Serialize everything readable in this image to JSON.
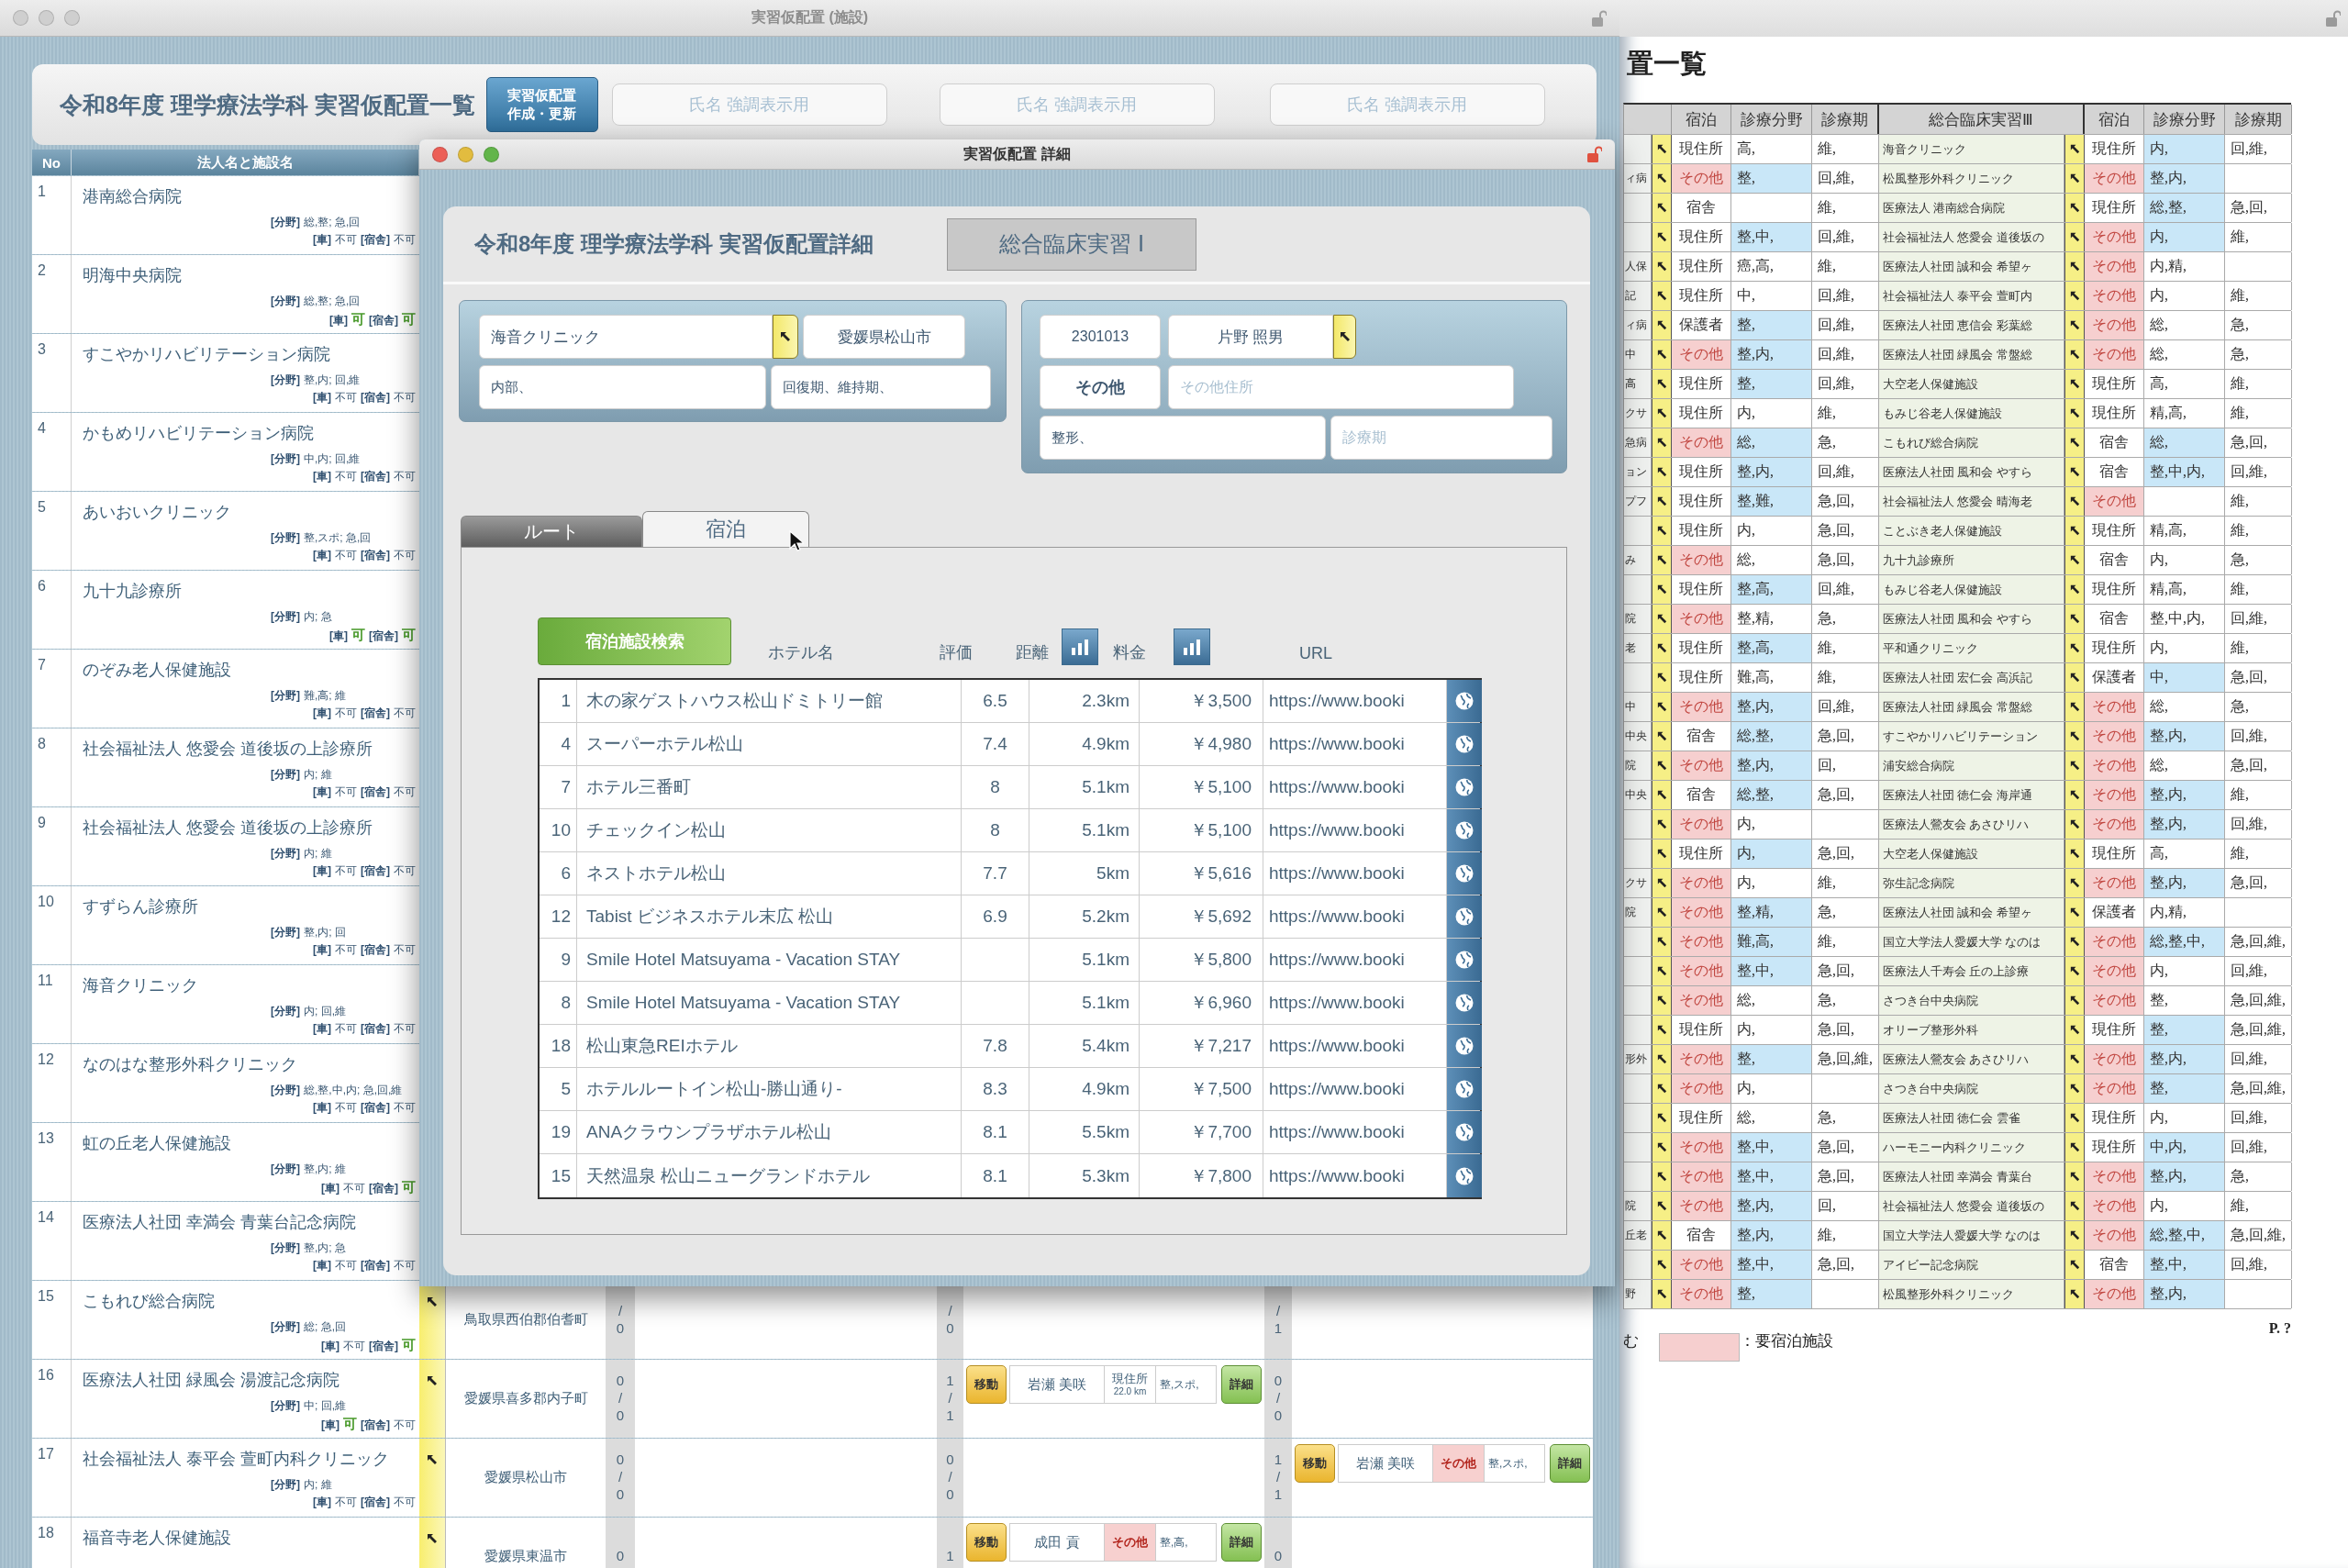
{
  "main_window": {
    "title": "実習仮配置 (施設)",
    "heading": "令和8年度 理学療法学科 実習仮配置一覧",
    "update_button": [
      "実習仮配置",
      "作成・更新"
    ],
    "highlight_fields": [
      {
        "placeholder": "氏名 強調表示用"
      },
      {
        "placeholder": "氏名 強調表示用"
      },
      {
        "placeholder": "氏名 強調表示用"
      }
    ],
    "columns": [
      "No",
      "法人名と施設名"
    ],
    "rows": [
      {
        "no": "1",
        "name": "港南総合病院",
        "field_label": "[分野]",
        "field": "総,整; 急,回",
        "car_label": "[車]",
        "car": "不可",
        "car_ok": false,
        "dorm_label": "[宿舎]",
        "dorm": "不可",
        "dorm_ok": false
      },
      {
        "no": "2",
        "name": "明海中央病院",
        "field_label": "[分野]",
        "field": "総,整; 急,回",
        "car_label": "[車]",
        "car": "可",
        "car_ok": true,
        "dorm_label": "[宿舎]",
        "dorm": "可",
        "dorm_ok": true
      },
      {
        "no": "3",
        "name": "すこやかリハビリテーション病院",
        "field_label": "[分野]",
        "field": "整,内; 回,維",
        "car_label": "[車]",
        "car": "不可",
        "car_ok": false,
        "dorm_label": "[宿舎]",
        "dorm": "不可",
        "dorm_ok": false
      },
      {
        "no": "4",
        "name": "かもめリハビリテーション病院",
        "field_label": "[分野]",
        "field": "中,内; 回,維",
        "car_label": "[車]",
        "car": "不可",
        "car_ok": false,
        "dorm_label": "[宿舎]",
        "dorm": "不可",
        "dorm_ok": false
      },
      {
        "no": "5",
        "name": "あいおいクリニック",
        "field_label": "[分野]",
        "field": "整,スポ; 急,回",
        "car_label": "[車]",
        "car": "不可",
        "car_ok": false,
        "dorm_label": "[宿舎]",
        "dorm": "不可",
        "dorm_ok": false
      },
      {
        "no": "6",
        "name": "九十九診療所",
        "field_label": "[分野]",
        "field": "内; 急",
        "car_label": "[車]",
        "car": "可",
        "car_ok": true,
        "dorm_label": "[宿舎]",
        "dorm": "可",
        "dorm_ok": true
      },
      {
        "no": "7",
        "name": "のぞみ老人保健施設",
        "field_label": "[分野]",
        "field": "難,高; 維",
        "car_label": "[車]",
        "car": "不可",
        "car_ok": false,
        "dorm_label": "[宿舎]",
        "dorm": "不可",
        "dorm_ok": false
      },
      {
        "no": "8",
        "name": "社会福祉法人 悠愛会 道後坂の上診療所",
        "field_label": "[分野]",
        "field": "内; 維",
        "car_label": "[車]",
        "car": "不可",
        "car_ok": false,
        "dorm_label": "[宿舎]",
        "dorm": "不可",
        "dorm_ok": false
      },
      {
        "no": "9",
        "name": "社会福祉法人 悠愛会 道後坂の上診療所",
        "field_label": "[分野]",
        "field": "内; 維",
        "car_label": "[車]",
        "car": "不可",
        "car_ok": false,
        "dorm_label": "[宿舎]",
        "dorm": "不可",
        "dorm_ok": false
      },
      {
        "no": "10",
        "name": "すずらん診療所",
        "field_label": "[分野]",
        "field": "整,内; 回",
        "car_label": "[車]",
        "car": "不可",
        "car_ok": false,
        "dorm_label": "[宿舎]",
        "dorm": "不可",
        "dorm_ok": false
      },
      {
        "no": "11",
        "name": "海音クリニック",
        "field_label": "[分野]",
        "field": "内; 回,維",
        "car_label": "[車]",
        "car": "不可",
        "car_ok": false,
        "dorm_label": "[宿舎]",
        "dorm": "不可",
        "dorm_ok": false
      },
      {
        "no": "12",
        "name": "なのはな整形外科クリニック",
        "field_label": "[分野]",
        "field": "総,整,中,内; 急,回,維",
        "car_label": "[車]",
        "car": "不可",
        "car_ok": false,
        "dorm_label": "[宿舎]",
        "dorm": "不可",
        "dorm_ok": false
      },
      {
        "no": "13",
        "name": "虹の丘老人保健施設",
        "field_label": "[分野]",
        "field": "整,内; 維",
        "car_label": "[車]",
        "car": "不可",
        "car_ok": false,
        "dorm_label": "[宿舎]",
        "dorm": "可",
        "dorm_ok": true
      },
      {
        "no": "14",
        "name": "医療法人社団 幸満会 青葉台記念病院",
        "field_label": "[分野]",
        "field": "整,内; 急",
        "car_label": "[車]",
        "car": "不可",
        "car_ok": false,
        "dorm_label": "[宿舎]",
        "dorm": "不可",
        "dorm_ok": false
      },
      {
        "no": "15",
        "name": "こもれび総合病院",
        "field_label": "[分野]",
        "field": "総; 急,回",
        "car_label": "[車]",
        "car": "不可",
        "car_ok": false,
        "dorm_label": "[宿舎]",
        "dorm": "可",
        "dorm_ok": true,
        "address": "鳥取県西伯郡伯耆町",
        "slots": [
          {
            "count": [
              "/",
              "0"
            ]
          },
          {
            "count": [
              "/",
              "0"
            ]
          },
          {
            "count": [
              "/",
              "1"
            ]
          }
        ]
      },
      {
        "no": "16",
        "name": "医療法人社団 緑風会 湯渡記念病院",
        "field_label": "[分野]",
        "field": "中; 回,維",
        "car_label": "[車]",
        "car": "可",
        "car_ok": true,
        "dorm_label": "[宿舎]",
        "dorm": "不可",
        "dorm_ok": false,
        "address": "愛媛県喜多郡内子町",
        "slots": [
          {
            "count": [
              "0",
              "/",
              "0"
            ]
          },
          {
            "count": [
              "1",
              "/",
              "1"
            ],
            "entry": {
              "move": "移動",
              "name": "岩瀬 美咲",
              "residence": "現住所",
              "distance": "22.0 km",
              "lodging": false,
              "field": "整,スポ,",
              "detail": "詳細"
            }
          },
          {
            "count": [
              "0",
              "/",
              "0"
            ]
          }
        ]
      },
      {
        "no": "17",
        "name": "社会福祉法人 泰平会 萱町内科クリニック",
        "field_label": "[分野]",
        "field": "内; 維",
        "car_label": "[車]",
        "car": "不可",
        "car_ok": false,
        "dorm_label": "[宿舎]",
        "dorm": "不可",
        "dorm_ok": false,
        "address": "愛媛県松山市",
        "slots": [
          {
            "count": [
              "0",
              "/",
              "0"
            ]
          },
          {
            "count": [
              "0",
              "/",
              "0"
            ]
          },
          {
            "count": [
              "1",
              "/",
              "1"
            ],
            "entry": {
              "move": "移動",
              "name": "岩瀬 美咲",
              "residence": "その他",
              "lodging": true,
              "field": "整,スポ,",
              "detail": "詳細"
            }
          }
        ]
      },
      {
        "no": "18",
        "name": "福音寺老人保健施設",
        "address": "愛媛県東温市",
        "slots": [
          {
            "count": [
              "0"
            ]
          },
          {
            "count": [
              "1"
            ],
            "entry": {
              "move": "移動",
              "name": "成田 貢",
              "residence": "その他",
              "lodging": true,
              "field": "整,高,",
              "detail": "詳細"
            }
          },
          {
            "count": [
              "0"
            ]
          }
        ]
      }
    ]
  },
  "detail_window": {
    "title": "実習仮配置 詳細",
    "heading": "令和8年度 理学療法学科 実習仮配置詳細",
    "course": "総合臨床実習 Ⅰ",
    "facility": {
      "name": "海音クリニック",
      "city": "愛媛県松山市",
      "departments": "内部、",
      "phases": "回復期、維持期、"
    },
    "student": {
      "id": "2301013",
      "name": "片野 照男",
      "residence": "その他",
      "address_placeholder": "その他住所",
      "field": "整形、",
      "period_placeholder": "診療期"
    },
    "tabs": [
      {
        "label": "ルート",
        "selected": false
      },
      {
        "label": "宿泊",
        "selected": true
      }
    ],
    "search_button": "宿泊施設検索",
    "columns": [
      "ホテル名",
      "評価",
      "距離",
      "料金",
      "URL"
    ],
    "hotels": [
      {
        "no": "1",
        "name": "木の家ゲストハウス松山ドミトリー館",
        "rating": "6.5",
        "distance": "2.3km",
        "price": "￥3,500",
        "url": "https://www.booki"
      },
      {
        "no": "4",
        "name": "スーパーホテル松山",
        "rating": "7.4",
        "distance": "4.9km",
        "price": "￥4,980",
        "url": "https://www.booki"
      },
      {
        "no": "7",
        "name": "ホテル三番町",
        "rating": "8",
        "distance": "5.1km",
        "price": "￥5,100",
        "url": "https://www.booki"
      },
      {
        "no": "10",
        "name": "チェックイン松山",
        "rating": "8",
        "distance": "5.1km",
        "price": "￥5,100",
        "url": "https://www.booki"
      },
      {
        "no": "6",
        "name": "ネストホテル松山",
        "rating": "7.7",
        "distance": "5km",
        "price": "￥5,616",
        "url": "https://www.booki"
      },
      {
        "no": "12",
        "name": "Tabist ビジネスホテル末広 松山",
        "rating": "6.9",
        "distance": "5.2km",
        "price": "￥5,692",
        "url": "https://www.booki"
      },
      {
        "no": "9",
        "name": "Smile Hotel Matsuyama - Vacation STAY",
        "distance": "5.1km",
        "price": "￥5,800",
        "url": "https://www.booki"
      },
      {
        "no": "8",
        "name": "Smile Hotel Matsuyama - Vacation STAY",
        "distance": "5.1km",
        "price": "￥6,960",
        "url": "https://www.booki"
      },
      {
        "no": "18",
        "name": "松山東急REIホテル",
        "rating": "7.8",
        "distance": "5.4km",
        "price": "￥7,217",
        "url": "https://www.booki"
      },
      {
        "no": "5",
        "name": "ホテルルートイン松山-勝山通り-",
        "rating": "8.3",
        "distance": "4.9km",
        "price": "￥7,500",
        "url": "https://www.booki"
      },
      {
        "no": "19",
        "name": "ANAクラウンプラザホテル松山",
        "rating": "8.1",
        "distance": "5.5km",
        "price": "￥7,700",
        "url": "https://www.booki"
      },
      {
        "no": "15",
        "name": "天然温泉 松山ニューグランドホテル",
        "rating": "8.1",
        "distance": "5.3km",
        "price": "￥7,800",
        "url": "https://www.booki"
      }
    ]
  },
  "roster_window": {
    "title": "置一覧",
    "columns": [
      "宿泊",
      "診療分野",
      "診療期",
      "総合臨床実習Ⅲ",
      "宿泊",
      "診療分野",
      "診療期"
    ],
    "rows": [
      {
        "stay1": "現住所",
        "lodging1": false,
        "field1": "高,",
        "mark1": false,
        "period1": "維,",
        "facility": "海音クリニック",
        "stay2": "現住所",
        "lodging2": false,
        "field2": "内,",
        "mark2": true,
        "period2": "回,維,"
      },
      {
        "cut": "ィ病",
        "stay1": "その他",
        "lodging1": true,
        "field1": "整,",
        "mark1": true,
        "period1": "回,維,",
        "facility": "松風整形外科クリニック",
        "stay2": "その他",
        "lodging2": true,
        "field2": "整,内,",
        "mark2": true
      },
      {
        "stay1": "宿舎",
        "lodging1": false,
        "mark1": false,
        "period1": "維,",
        "facility": "医療法人 港南総合病院",
        "stay2": "現住所",
        "lodging2": false,
        "field2": "総,整,",
        "mark2": true,
        "period2": "急,回,"
      },
      {
        "stay1": "現住所",
        "lodging1": false,
        "field1": "整,中,",
        "mark1": true,
        "period1": "回,維,",
        "facility": "社会福祉法人 悠愛会 道後坂の",
        "stay2": "その他",
        "lodging2": true,
        "field2": "内,",
        "mark2": true,
        "period2": "維,"
      },
      {
        "cut": "人保",
        "stay1": "現住所",
        "lodging1": false,
        "field1": "癌,高,",
        "mark1": false,
        "period1": "維,",
        "facility": "医療法人社団 誠和会 希望ヶ",
        "stay2": "その他",
        "lodging2": true,
        "field2": "内,精,",
        "mark2": false
      },
      {
        "cut": "記",
        "stay1": "現住所",
        "lodging1": false,
        "field1": "中,",
        "mark1": false,
        "period1": "回,維,",
        "facility": "社会福祉法人 泰平会 萱町内",
        "stay2": "その他",
        "lodging2": true,
        "field2": "内,",
        "mark2": false,
        "period2": "維,"
      },
      {
        "cut": "ィ病",
        "stay1": "保護者",
        "lodging1": false,
        "field1": "整,",
        "mark1": true,
        "period1": "回,維,",
        "facility": "医療法人社団 恵信会 彩葉総",
        "stay2": "その他",
        "lodging2": true,
        "field2": "総,",
        "mark2": false,
        "period2": "急,"
      },
      {
        "cut": "中",
        "stay1": "その他",
        "lodging1": true,
        "field1": "整,内,",
        "mark1": true,
        "period1": "回,維,",
        "facility": "医療法人社団 緑風会 常盤総",
        "stay2": "その他",
        "lodging2": true,
        "field2": "総,",
        "mark2": false,
        "period2": "急,"
      },
      {
        "cut": "高",
        "stay1": "現住所",
        "lodging1": false,
        "field1": "整,",
        "mark1": true,
        "period1": "回,維,",
        "facility": "大空老人保健施設",
        "stay2": "現住所",
        "lodging2": false,
        "field2": "高,",
        "mark2": false,
        "period2": "維,"
      },
      {
        "cut": "クサ",
        "stay1": "現住所",
        "lodging1": false,
        "field1": "内,",
        "mark1": false,
        "period1": "維,",
        "facility": "もみじ谷老人保健施設",
        "stay2": "現住所",
        "lodging2": false,
        "field2": "精,高,",
        "mark2": false,
        "period2": "維,"
      },
      {
        "cut": "急病",
        "stay1": "その他",
        "lodging1": true,
        "field1": "総,",
        "mark1": true,
        "period1": "急,",
        "facility": "こもれび総合病院",
        "stay2": "宿舎",
        "lodging2": false,
        "field2": "総,",
        "mark2": true,
        "period2": "急,回,"
      },
      {
        "cut": "ョン",
        "stay1": "現住所",
        "lodging1": false,
        "field1": "整,内,",
        "mark1": true,
        "period1": "回,維,",
        "facility": "医療法人社団 風和会 やすら",
        "stay2": "宿舎",
        "lodging2": false,
        "field2": "整,中,内,",
        "mark2": true,
        "period2": "回,維,"
      },
      {
        "cut": "プフ",
        "stay1": "現住所",
        "lodging1": false,
        "field1": "整,難,",
        "mark1": true,
        "period1": "急,回,",
        "facility": "社会福祉法人 悠愛会 晴海老",
        "stay2": "その他",
        "lodging2": true,
        "mark2": false,
        "period2": "維,"
      },
      {
        "stay1": "現住所",
        "lodging1": false,
        "field1": "内,",
        "mark1": false,
        "period1": "急,回,",
        "facility": "ことぶき老人保健施設",
        "stay2": "現住所",
        "lodging2": false,
        "field2": "精,高,",
        "mark2": false,
        "period2": "維,"
      },
      {
        "cut": "み",
        "stay1": "その他",
        "lodging1": true,
        "field1": "総,",
        "mark1": false,
        "period1": "急,回,",
        "facility": "九十九診療所",
        "stay2": "宿舎",
        "lodging2": false,
        "field2": "内,",
        "mark2": false,
        "period2": "急,"
      },
      {
        "stay1": "現住所",
        "lodging1": false,
        "field1": "整,高,",
        "mark1": true,
        "period1": "回,維,",
        "facility": "もみじ谷老人保健施設",
        "stay2": "現住所",
        "lodging2": false,
        "field2": "精,高,",
        "mark2": false,
        "period2": "維,"
      },
      {
        "cut": "院",
        "stay1": "その他",
        "lodging1": true,
        "field1": "整,精,",
        "mark1": false,
        "period1": "急,",
        "facility": "医療法人社団 風和会 やすら",
        "stay2": "宿舎",
        "lodging2": false,
        "field2": "整,中,内,",
        "mark2": false,
        "period2": "回,維,"
      },
      {
        "cut": "老",
        "stay1": "現住所",
        "lodging1": false,
        "field1": "整,高,",
        "mark1": true,
        "period1": "維,",
        "facility": "平和通クリニック",
        "stay2": "現住所",
        "lodging2": false,
        "field2": "内,",
        "mark2": false,
        "period2": "維,"
      },
      {
        "stay1": "現住所",
        "lodging1": false,
        "field1": "難,高,",
        "mark1": false,
        "period1": "維,",
        "facility": "医療法人社団 宏仁会 高浜記",
        "stay2": "保護者",
        "lodging2": false,
        "field2": "中,",
        "mark2": true,
        "period2": "急,回,"
      },
      {
        "cut": "中",
        "stay1": "その他",
        "lodging1": true,
        "field1": "整,内,",
        "mark1": true,
        "period1": "回,維,",
        "facility": "医療法人社団 緑風会 常盤総",
        "stay2": "その他",
        "lodging2": true,
        "field2": "総,",
        "mark2": false,
        "period2": "急,"
      },
      {
        "cut": "中央",
        "stay1": "宿舎",
        "lodging1": false,
        "field1": "総,整,",
        "mark1": true,
        "period1": "急,回,",
        "facility": "すこやかリハビリテーション",
        "stay2": "その他",
        "lodging2": true,
        "field2": "整,内,",
        "mark2": true,
        "period2": "回,維,"
      },
      {
        "cut": "院",
        "stay1": "その他",
        "lodging1": true,
        "field1": "整,内,",
        "mark1": true,
        "period1": "回,",
        "facility": "浦安総合病院",
        "stay2": "その他",
        "lodging2": true,
        "field2": "総,",
        "mark2": false,
        "period2": "急,回,"
      },
      {
        "cut": "中央",
        "stay1": "宿舎",
        "lodging1": false,
        "field1": "総,整,",
        "mark1": true,
        "period1": "急,回,",
        "facility": "医療法人社団 徳仁会 海岸通",
        "stay2": "その他",
        "lodging2": true,
        "field2": "整,内,",
        "mark2": true,
        "period2": "維,"
      },
      {
        "stay1": "その他",
        "lodging1": true,
        "field1": "内,",
        "mark1": false,
        "facility": "医療法人鶯友会 あさひリハ",
        "stay2": "その他",
        "lodging2": true,
        "field2": "整,内,",
        "mark2": true,
        "period2": "回,維,"
      },
      {
        "stay1": "現住所",
        "lodging1": false,
        "field1": "内,",
        "mark1": true,
        "period1": "急,回,",
        "facility": "大空老人保健施設",
        "stay2": "現住所",
        "lodging2": false,
        "field2": "高,",
        "mark2": false,
        "period2": "維,"
      },
      {
        "cut": "クサ",
        "stay1": "その他",
        "lodging1": true,
        "field1": "内,",
        "mark1": false,
        "period1": "維,",
        "facility": "弥生記念病院",
        "stay2": "その他",
        "lodging2": true,
        "field2": "整,内,",
        "mark2": true,
        "period2": "急,回,"
      },
      {
        "cut": "院",
        "stay1": "その他",
        "lodging1": true,
        "field1": "整,精,",
        "mark1": true,
        "period1": "急,",
        "facility": "医療法人社団 誠和会 希望ヶ",
        "stay2": "保護者",
        "lodging2": false,
        "field2": "内,精,",
        "mark2": false
      },
      {
        "stay1": "その他",
        "lodging1": true,
        "field1": "難,高,",
        "mark1": true,
        "period1": "維,",
        "facility": "国立大学法人愛媛大学 なのは",
        "stay2": "その他",
        "lodging2": true,
        "field2": "総,整,中,",
        "mark2": true,
        "period2": "急,回,維,"
      },
      {
        "stay1": "その他",
        "lodging1": true,
        "field1": "整,中,",
        "mark1": true,
        "period1": "急,回,",
        "facility": "医療法人千寿会 丘の上診療",
        "stay2": "その他",
        "lodging2": true,
        "field2": "内,",
        "mark2": false,
        "period2": "回,維,"
      },
      {
        "stay1": "その他",
        "lodging1": true,
        "field1": "総,",
        "mark1": false,
        "period1": "急,",
        "facility": "さつき台中央病院",
        "stay2": "その他",
        "lodging2": true,
        "field2": "整,",
        "mark2": false,
        "period2": "急,回,維,"
      },
      {
        "stay1": "現住所",
        "lodging1": false,
        "field1": "内,",
        "mark1": false,
        "period1": "急,回,",
        "facility": "オリーブ整形外科",
        "stay2": "現住所",
        "lodging2": false,
        "field2": "整,",
        "mark2": true,
        "period2": "急,回,維,"
      },
      {
        "cut": "形外",
        "stay1": "その他",
        "lodging1": true,
        "field1": "整,",
        "mark1": true,
        "period1": "急,回,維,",
        "facility": "医療法人鶯友会 あさひリハ",
        "stay2": "その他",
        "lodging2": true,
        "field2": "整,内,",
        "mark2": true,
        "period2": "回,維,"
      },
      {
        "stay1": "その他",
        "lodging1": true,
        "field1": "内,",
        "mark1": false,
        "facility": "さつき台中央病院",
        "stay2": "その他",
        "lodging2": true,
        "field2": "整,",
        "mark2": true,
        "period2": "急,回,維,"
      },
      {
        "stay1": "現住所",
        "lodging1": false,
        "field1": "総,",
        "mark1": false,
        "period1": "急,",
        "facility": "医療法人社団 徳仁会 雲雀",
        "stay2": "現住所",
        "lodging2": false,
        "field2": "内,",
        "mark2": false,
        "period2": "回,維,"
      },
      {
        "stay1": "その他",
        "lodging1": true,
        "field1": "整,中,",
        "mark1": true,
        "period1": "急,回,",
        "facility": "ハーモニー内科クリニック",
        "stay2": "現住所",
        "lodging2": false,
        "field2": "中,内,",
        "mark2": true,
        "period2": "回,維,"
      },
      {
        "stay1": "その他",
        "lodging1": true,
        "field1": "整,中,",
        "mark1": true,
        "period1": "急,回,",
        "facility": "医療法人社団 幸満会 青葉台",
        "stay2": "その他",
        "lodging2": true,
        "field2": "整,内,",
        "mark2": true,
        "period2": "急,"
      },
      {
        "cut": "院",
        "stay1": "その他",
        "lodging1": true,
        "field1": "整,内,",
        "mark1": true,
        "period1": "回,",
        "facility": "社会福祉法人 悠愛会 道後坂の",
        "stay2": "その他",
        "lodging2": true,
        "field2": "内,",
        "mark2": false,
        "period2": "維,"
      },
      {
        "cut": "丘老",
        "stay1": "宿舎",
        "lodging1": false,
        "field1": "整,内,",
        "mark1": true,
        "period1": "維,",
        "facility": "国立大学法人愛媛大学 なのは",
        "stay2": "その他",
        "lodging2": true,
        "field2": "総,整,中,",
        "mark2": true,
        "period2": "急,回,維,"
      },
      {
        "stay1": "その他",
        "lodging1": true,
        "field1": "整,中,",
        "mark1": true,
        "period1": "急,回,",
        "facility": "アイビー記念病院",
        "stay2": "宿舎",
        "lodging2": false,
        "field2": "整,中,",
        "mark2": true,
        "period2": "回,維,"
      },
      {
        "cut": "野",
        "stay1": "その他",
        "lodging1": true,
        "field1": "整,",
        "mark1": true,
        "facility": "松風整形外科クリニック",
        "stay2": "その他",
        "lodging2": true,
        "field2": "整,内,",
        "mark2": true
      }
    ],
    "legend": {
      "prefix": "む",
      "label": "：要宿泊施設",
      "page": "P. ?"
    }
  }
}
